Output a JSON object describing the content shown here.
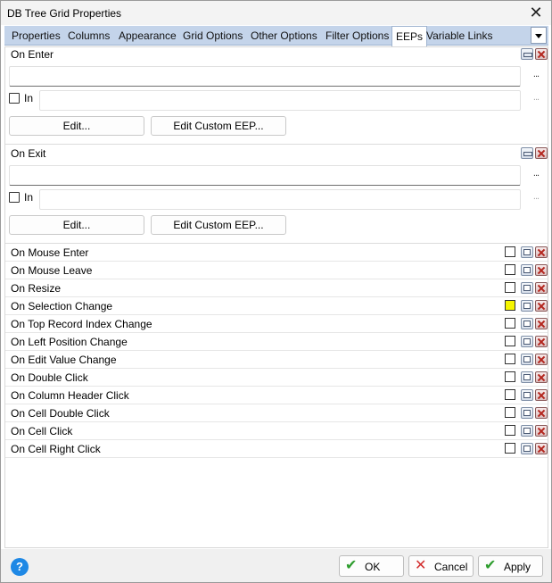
{
  "window": {
    "title": "DB Tree Grid Properties"
  },
  "tabs": [
    {
      "label": "Properties"
    },
    {
      "label": "Columns"
    },
    {
      "label": "Appearance"
    },
    {
      "label": "Grid Options"
    },
    {
      "label": "Other Options"
    },
    {
      "label": "Filter Options"
    },
    {
      "label": "EEPs",
      "active": true
    },
    {
      "label": "Variable Links"
    }
  ],
  "on_enter": {
    "label": "On Enter",
    "value": "",
    "in_label": "In",
    "in_checked": false,
    "in_value": "",
    "dots": "...",
    "edit_label": "Edit...",
    "edit_custom_label": "Edit Custom EEP..."
  },
  "on_exit": {
    "label": "On Exit",
    "value": "",
    "in_label": "In",
    "in_checked": false,
    "in_value": "",
    "dots": "...",
    "edit_label": "Edit...",
    "edit_custom_label": "Edit Custom EEP..."
  },
  "events": [
    {
      "label": "On Mouse Enter",
      "checked": false
    },
    {
      "label": "On Mouse Leave",
      "checked": false
    },
    {
      "label": "On Resize",
      "checked": false
    },
    {
      "label": "On Selection Change",
      "checked": false,
      "highlight": "yellow"
    },
    {
      "label": "On Top Record Index Change",
      "checked": false
    },
    {
      "label": "On Left Position Change",
      "checked": false
    },
    {
      "label": "On Edit Value Change",
      "checked": false
    },
    {
      "label": "On Double Click",
      "checked": false
    },
    {
      "label": "On Column Header Click",
      "checked": false
    },
    {
      "label": "On Cell Double Click",
      "checked": false
    },
    {
      "label": "On Cell Click",
      "checked": false
    },
    {
      "label": "On Cell Right Click",
      "checked": false
    }
  ],
  "footer": {
    "help": "?",
    "ok_label": "OK",
    "cancel_label": "Cancel",
    "apply_label": "Apply"
  },
  "colors": {
    "tab_bar": "#c4d4ea",
    "help_blue": "#1e88e5",
    "highlight_yellow": "#f5f500",
    "ok_green": "#2e9d2e",
    "cancel_red": "#d32f2f"
  }
}
